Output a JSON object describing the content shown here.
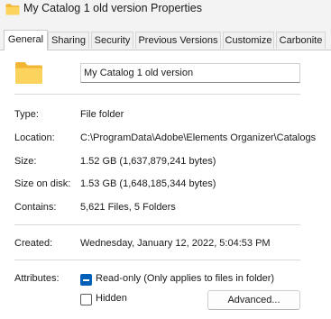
{
  "window": {
    "title": "My Catalog 1 old version Properties"
  },
  "tabs": [
    {
      "label": "General",
      "active": true
    },
    {
      "label": "Sharing"
    },
    {
      "label": "Security"
    },
    {
      "label": "Previous Versions"
    },
    {
      "label": "Customize"
    },
    {
      "label": "Carbonite"
    }
  ],
  "general": {
    "name_value": "My Catalog 1 old version",
    "type_label": "Type:",
    "type_value": "File folder",
    "location_label": "Location:",
    "location_value": "C:\\ProgramData\\Adobe\\Elements Organizer\\Catalogs",
    "size_label": "Size:",
    "size_value": "1.52 GB (1,637,879,241 bytes)",
    "size_on_disk_label": "Size on disk:",
    "size_on_disk_value": "1.53 GB (1,648,185,344 bytes)",
    "contains_label": "Contains:",
    "contains_value": "5,621 Files, 5 Folders",
    "created_label": "Created:",
    "created_value": "Wednesday, January 12, 2022, 5:04:53 PM",
    "attributes_label": "Attributes:",
    "readonly_label": "Read-only (Only applies to files in folder)",
    "readonly_state": "indeterminate",
    "hidden_label": "Hidden",
    "hidden_state": "unchecked",
    "advanced_button": "Advanced..."
  },
  "icons": {
    "title_icon": "folder-icon",
    "folder_icon": "folder-icon",
    "folder_color": "#f8c542"
  }
}
